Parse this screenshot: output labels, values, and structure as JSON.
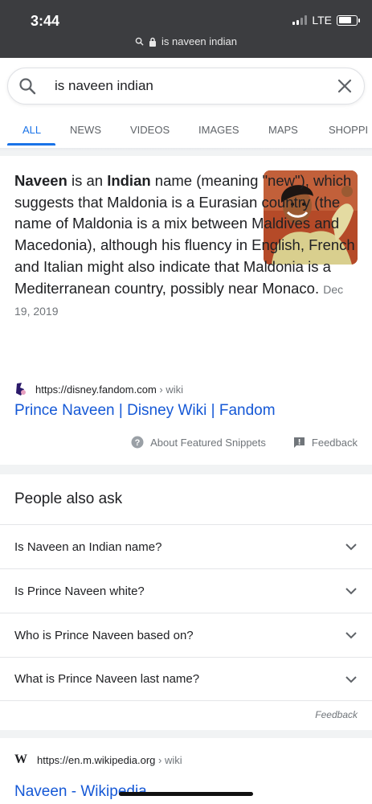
{
  "status_bar": {
    "time": "3:44",
    "network": "LTE",
    "url": "is naveen indian",
    "battery_level": 0.75
  },
  "search": {
    "query": "is naveen indian"
  },
  "tabs": [
    "ALL",
    "NEWS",
    "VIDEOS",
    "IMAGES",
    "MAPS",
    "SHOPPI"
  ],
  "active_tab": "ALL",
  "snippet": {
    "bold1": "Naveen",
    "text1": " is an ",
    "bold2": "Indian",
    "text2": " name (meaning \"new\"), which suggests that Maldonia is a Eurasian country (the name of Maldonia is a mix between Maldives and Macedonia), although his fluency in English, French and Italian might also indicate that Maldonia is a Mediterranean country, possibly near Monaco.",
    "date": "Dec 19, 2019",
    "source_url": "https://disney.fandom.com",
    "source_path": "› wiki",
    "title": "Prince Naveen | Disney Wiki | Fandom",
    "about_label": "About Featured Snippets",
    "feedback_label": "Feedback"
  },
  "people_also_ask": {
    "title": "People also ask",
    "questions": [
      "Is Naveen an Indian name?",
      "Is Prince Naveen white?",
      "Who is Prince Naveen based on?",
      "What is Prince Naveen last name?"
    ],
    "feedback_label": "Feedback"
  },
  "wiki_result": {
    "source_url": "https://en.m.wikipedia.org",
    "source_path": "› wiki",
    "title": "Naveen - Wikipedia"
  },
  "colors": {
    "link": "#1558d6",
    "active_tab": "#1a73e8",
    "status_bar": "#3c3d40"
  }
}
